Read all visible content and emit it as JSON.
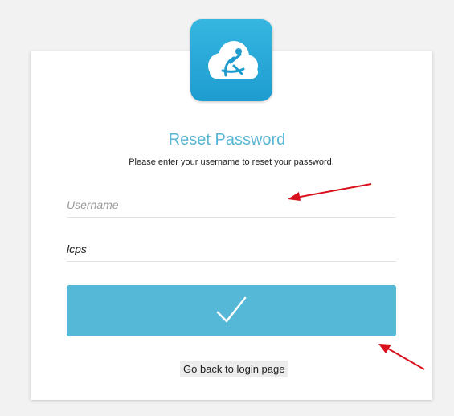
{
  "header": {
    "logo_icon": "cloud-person-icon",
    "title": "Reset Password",
    "instruction": "Please enter your username to reset your password."
  },
  "form": {
    "username_placeholder": "Username",
    "password_value": "lcps",
    "submit_icon": "checkmark-icon"
  },
  "footer": {
    "back_label": "Go back to login page"
  },
  "colors": {
    "accent": "#55b8d6",
    "logo_bg": "#29a9da",
    "annotation_arrow": "#d9111d"
  }
}
